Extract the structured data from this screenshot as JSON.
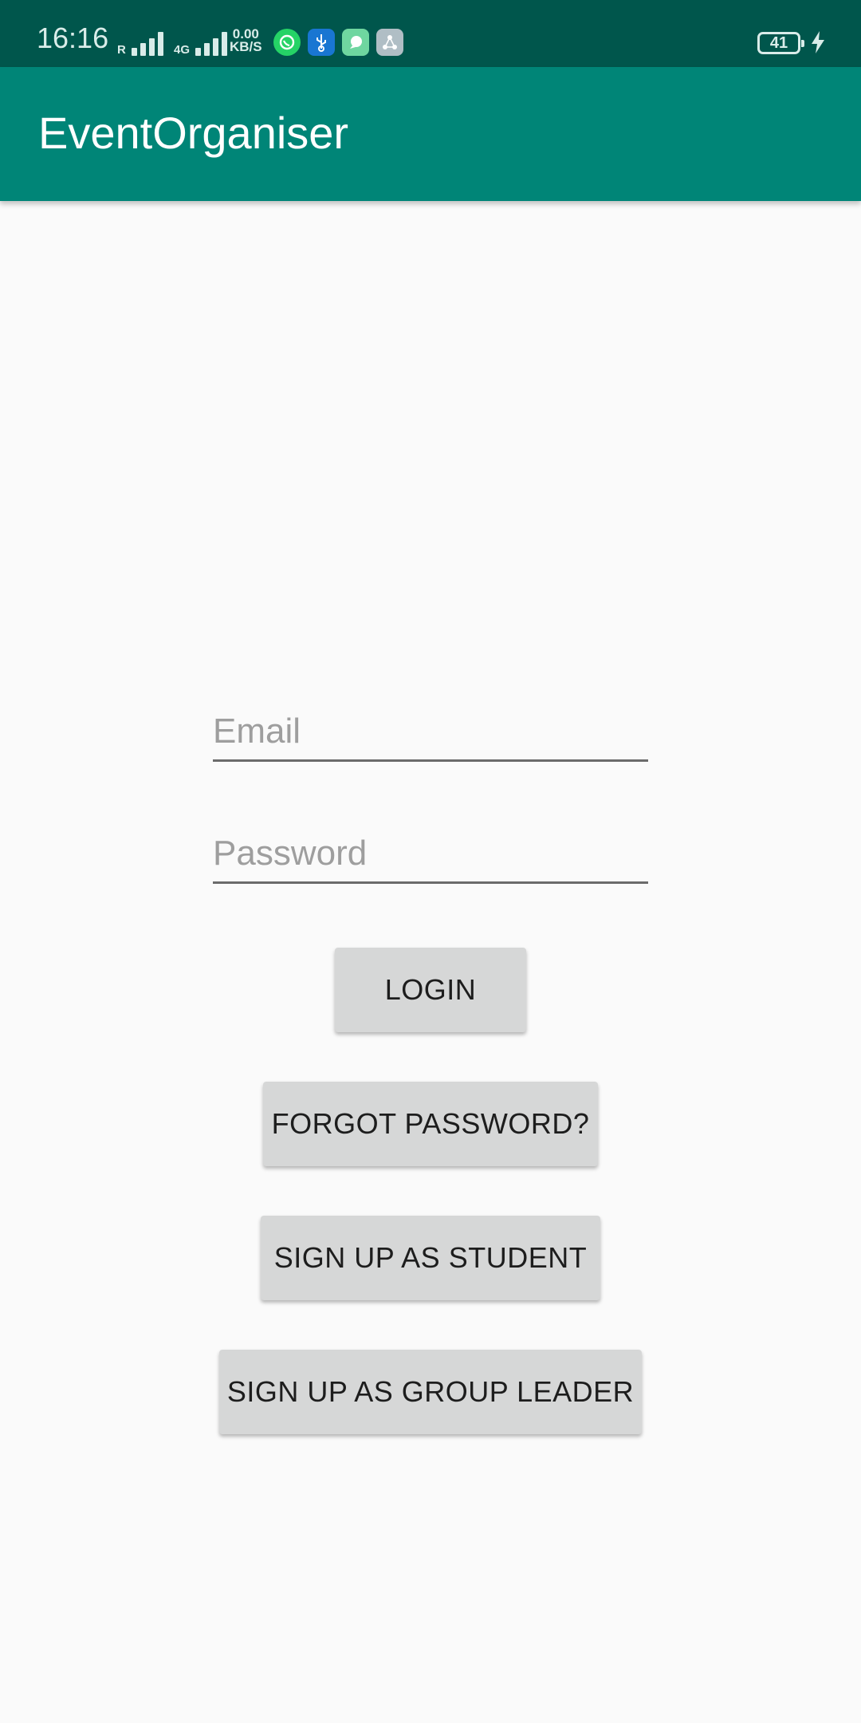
{
  "status_bar": {
    "time": "16:16",
    "signal1_label": "R",
    "signal2_label": "4G",
    "speed_value": "0.00",
    "speed_unit": "KB/S",
    "battery_level": "41",
    "app_icons": [
      "whatsapp-icon",
      "usb-icon",
      "chat-icon",
      "share-icon"
    ]
  },
  "app_bar": {
    "title": "EventOrganiser",
    "color": "#008577",
    "status_color": "#00564c"
  },
  "form": {
    "email_placeholder": "Email",
    "password_placeholder": "Password"
  },
  "buttons": {
    "login": "LOGIN",
    "forgot_password": "FORGOT PASSWORD?",
    "signup_student": "SIGN UP AS STUDENT",
    "signup_group_leader": "SIGN UP AS GROUP LEADER"
  }
}
